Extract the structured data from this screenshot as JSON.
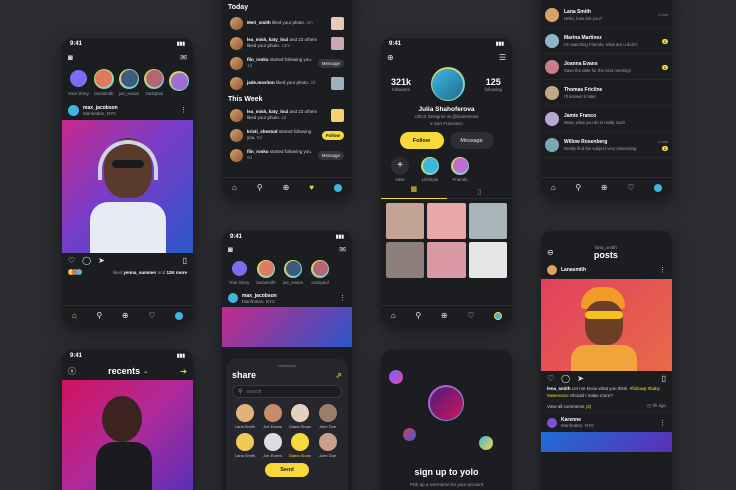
{
  "feed": {
    "time": "9:41",
    "stories": [
      {
        "name": "Your Story",
        "color": "#7b6cf6"
      },
      {
        "name": "lanasmith",
        "color": "#e07a5f"
      },
      {
        "name": "joe_evans",
        "color": "#3d5a80"
      },
      {
        "name": "zackpaul",
        "color": "#b56576"
      },
      {
        "name": "",
        "color": "#a06cd5"
      }
    ],
    "post": {
      "user": "max_jacobson",
      "location": "Manhattan, NYC",
      "liked_by": "liked",
      "liked_user": "yenna_summer",
      "liked_and": "and",
      "liked_count": "12K more"
    }
  },
  "activity": {
    "today_label": "Today",
    "week_label": "This Week",
    "today": [
      {
        "user": "Meri_smith",
        "action": "liked your photo.",
        "time": "4m",
        "kind": "thumb",
        "color": "#e8c9b8"
      },
      {
        "user": "lea_mish, katy_loui",
        "action": "and 23 others liked your photo.",
        "time": "12m",
        "kind": "thumb",
        "color": "#c8a9b0"
      },
      {
        "user": "flin_rosko",
        "action": "started following you.",
        "time": "1d",
        "kind": "button",
        "button": "Message"
      },
      {
        "user": "jade.moviton",
        "action": "liked your photo.",
        "time": "2d",
        "kind": "thumb",
        "color": "#9db4c0"
      }
    ],
    "week": [
      {
        "user": "lea_mish, katy_loui",
        "action": "and 23 others liked your photo.",
        "time": "3d",
        "kind": "thumb",
        "color": "#f3d36b"
      },
      {
        "user": "kristi_shestod",
        "action": "started following you.",
        "time": "5d",
        "kind": "button-yellow",
        "button": "Follow"
      },
      {
        "user": "flin_rosko",
        "action": "started following you.",
        "time": "6d",
        "kind": "button",
        "button": "Message"
      }
    ]
  },
  "profile": {
    "time": "9:41",
    "followers_count": "321k",
    "followers_label": "followers",
    "following_count": "125",
    "following_label": "following",
    "name": "Julia Shahoferova",
    "role": "UI/UX Designer at @brainmeow",
    "location": "San Francisco",
    "follow_label": "Follow",
    "message_label": "Message",
    "highlights": [
      {
        "name": "New"
      },
      {
        "name": "Lifestyle",
        "color": "#3fb6e0"
      },
      {
        "name": "Friends",
        "color": "#c06cd0"
      }
    ],
    "grid_colors": [
      "#c2a394",
      "#e8a9a9",
      "#a9b4b8",
      "#8d7f7a",
      "#d99aa4",
      "#e6e6e6"
    ]
  },
  "messages": {
    "chats": [
      {
        "name": "Lana Smith",
        "text": "Hello, how are you?",
        "time": "1 min",
        "badge": "",
        "color": "#d9a066"
      },
      {
        "name": "Marina Martinez",
        "text": "I'm watching Friends, what are u doin?",
        "time": "",
        "badge": "1",
        "color": "#8bb6c9"
      },
      {
        "name": "Joanna Evans",
        "text": "Save the date for the next meeting!",
        "time": "",
        "badge": "1",
        "color": "#c97c8b"
      },
      {
        "name": "Thomas Fricline",
        "text": "I'll answer it later.",
        "time": "",
        "badge": "",
        "color": "#bfa78a"
      },
      {
        "name": "Jamie Franco",
        "text": "Wow, what you do is really cool!",
        "time": "",
        "badge": "",
        "color": "#b9a9d4"
      },
      {
        "name": "Willow Rosenberg",
        "text": "Really find the subject very interesting",
        "time": "1 min",
        "badge": "1",
        "color": "#7ca7b5"
      }
    ]
  },
  "feed2": {
    "time": "9:41",
    "stories": [
      {
        "name": "Your Story",
        "color": "#7b6cf6"
      },
      {
        "name": "lanasmith",
        "color": "#e07a5f"
      },
      {
        "name": "joe_evans",
        "color": "#3d5a80"
      },
      {
        "name": "zackpaul",
        "color": "#b56576"
      }
    ],
    "post_user": "max_jacobson",
    "post_location": "Manhattan, NYC"
  },
  "share": {
    "title": "share",
    "search_placeholder": "search",
    "people": [
      {
        "name": "Lana Smith",
        "color": "#e2b27a"
      },
      {
        "name": "Joe Evans",
        "color": "#c58d6b"
      },
      {
        "name": "Diana Sloan",
        "color": "#e7cfc0"
      },
      {
        "name": "John Doe",
        "color": "#9a7f6b"
      },
      {
        "name": "Lana Smith",
        "color": "#f0c95a"
      },
      {
        "name": "Joe Evans",
        "color": "#dddddd"
      },
      {
        "name": "Diana Sloan",
        "color": "#f8d93b",
        "selected": true
      },
      {
        "name": "John Doe",
        "color": "#c9a08a"
      }
    ],
    "send_label": "Send"
  },
  "recents": {
    "time": "9:41",
    "title": "recents"
  },
  "signup": {
    "title": "sign up to yolo",
    "subtitle": "Pick up a username for your account"
  },
  "post_detail": {
    "user_small": "lana_smith",
    "title": "posts",
    "user": "Lanasmith",
    "caption_user": "lena_smith",
    "caption": "Let me know what you think.",
    "hashtags": "#followp #baby #awesome",
    "caption_more": "Should I make more?",
    "view_comments": "View all comments",
    "comments_count": "(3)",
    "comment_time": "3h ago",
    "second_user": "Karenne",
    "second_location": "Manhattan, NYC"
  }
}
